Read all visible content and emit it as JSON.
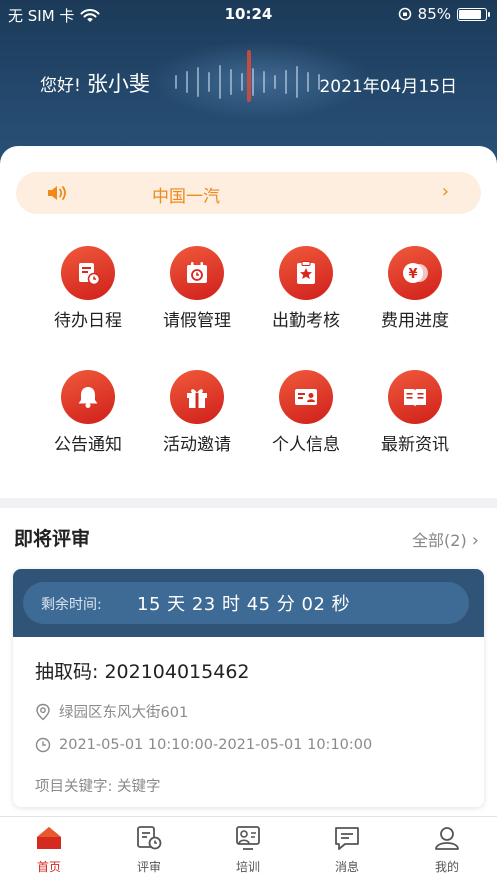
{
  "status_bar": {
    "carrier": "无 SIM 卡",
    "time": "10:24",
    "battery_pct": "85%",
    "battery_level": 0.85
  },
  "header": {
    "greeting": "您好!",
    "user_name": "张小斐",
    "date": "2021年04月15日"
  },
  "notice": {
    "text": "中国一汽",
    "arrow": "›"
  },
  "quick_actions": [
    {
      "label": "待办日程",
      "icon": "schedule-icon"
    },
    {
      "label": "请假管理",
      "icon": "leave-calendar-icon"
    },
    {
      "label": "出勤考核",
      "icon": "attendance-star-icon"
    },
    {
      "label": "费用进度",
      "icon": "yen-coins-icon"
    },
    {
      "label": "公告通知",
      "icon": "bell-icon"
    },
    {
      "label": "活动邀请",
      "icon": "gift-icon"
    },
    {
      "label": "个人信息",
      "icon": "id-card-icon"
    },
    {
      "label": "最新资讯",
      "icon": "book-icon"
    }
  ],
  "review": {
    "title": "即将评审",
    "view_all": "全部(2)",
    "countdown_label": "剩余时间:",
    "countdown_value": "15 天 23 时 45 分 02 秒",
    "code": "抽取码:  202104015462",
    "address": "绿园区东风大街601",
    "time_range": "2021-05-01 10:10:00-2021-05-01 10:10:00",
    "keywords": "项目关键字:  关键字"
  },
  "tabs": [
    {
      "label": "首页",
      "icon": "home-icon",
      "active": true
    },
    {
      "label": "评审",
      "icon": "review-icon",
      "active": false
    },
    {
      "label": "培训",
      "icon": "training-icon",
      "active": false
    },
    {
      "label": "消息",
      "icon": "message-icon",
      "active": false
    },
    {
      "label": "我的",
      "icon": "profile-icon",
      "active": false
    }
  ],
  "colors": {
    "accent": "#d42a1f",
    "header_blue": "#244a6e",
    "notice_orange": "#ee8a1a"
  }
}
